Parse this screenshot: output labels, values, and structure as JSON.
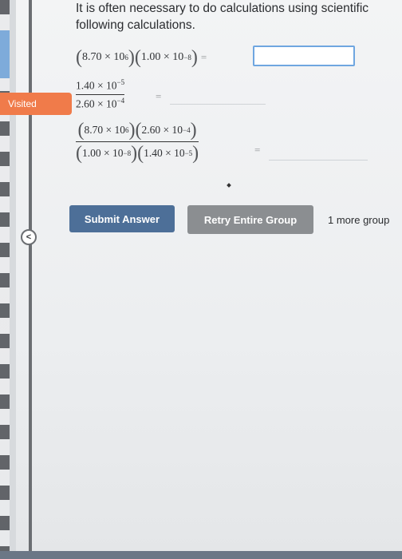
{
  "sidebar": {
    "visited_label": "Visited",
    "collapse_icon": "chevron-left-icon"
  },
  "question": {
    "intro_line1": "It is often necessary to do calculations using scientific",
    "intro_line2": "following calculations."
  },
  "row1": {
    "a": "8.70 × 10",
    "a_exp": "6",
    "b": "1.00 × 10",
    "b_exp": "−8",
    "equals": "="
  },
  "row2": {
    "num": "1.40 × 10",
    "num_exp": "−5",
    "den": "2.60 × 10",
    "den_exp": "−4",
    "equals": "="
  },
  "row3": {
    "num_a": "8.70 × 10",
    "num_a_exp": "6",
    "num_b": "2.60 × 10",
    "num_b_exp": "−4",
    "den_a": "1.00 × 10",
    "den_a_exp": "−8",
    "den_b": "1.40 × 10",
    "den_b_exp": "−5",
    "equals": "="
  },
  "actions": {
    "submit_label": "Submit Answer",
    "retry_label": "Retry Entire Group",
    "more_group_text": "1 more group"
  },
  "colors": {
    "submit": "#4d6f98",
    "retry": "#8b8e91",
    "visited": "#f07b4a",
    "input_border": "#6fa6e0"
  }
}
